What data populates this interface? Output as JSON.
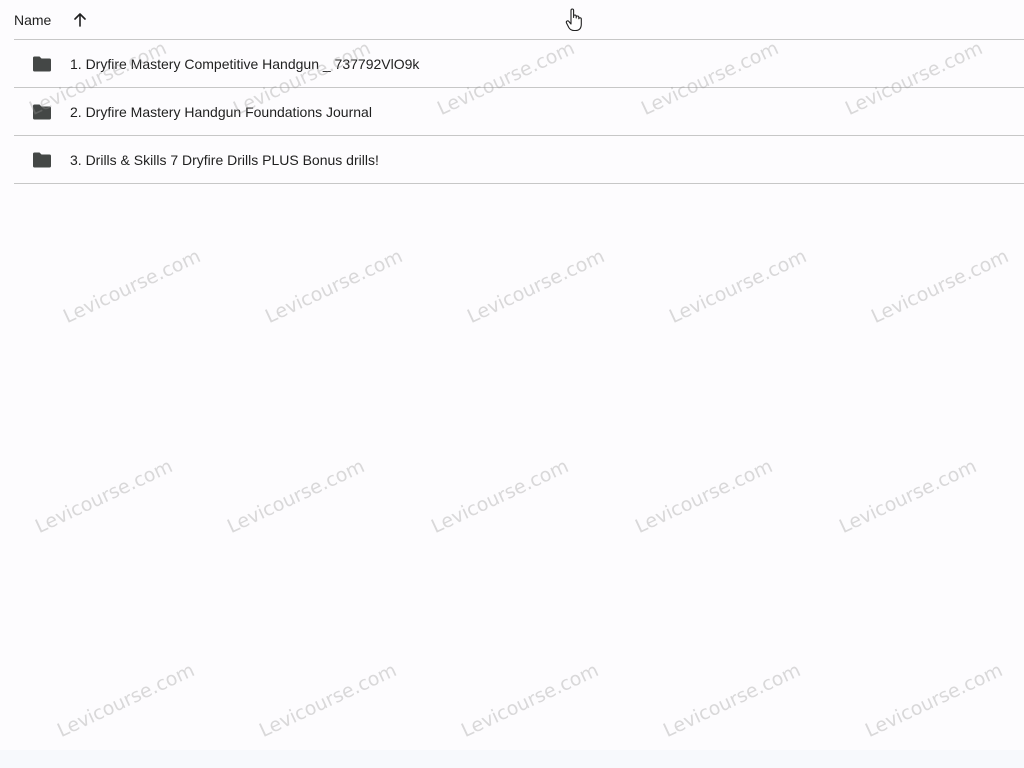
{
  "header": {
    "name_label": "Name",
    "sort_icon": "arrow-up-icon"
  },
  "files": [
    {
      "icon": "folder-icon",
      "name": "1. Dryfire Mastery Competitive Handgun _ 737792VlO9k"
    },
    {
      "icon": "folder-icon",
      "name": "2. Dryfire Mastery Handgun Foundations Journal"
    },
    {
      "icon": "folder-icon",
      "name": "3. Drills & Skills 7 Dryfire Drills PLUS Bonus drills!"
    }
  ],
  "watermark": {
    "text": "Levicourse.com"
  },
  "colors": {
    "text": "#1f1f1f",
    "icon": "#444746",
    "divider": "#c7c7c7",
    "background": "#fdfcfe"
  }
}
